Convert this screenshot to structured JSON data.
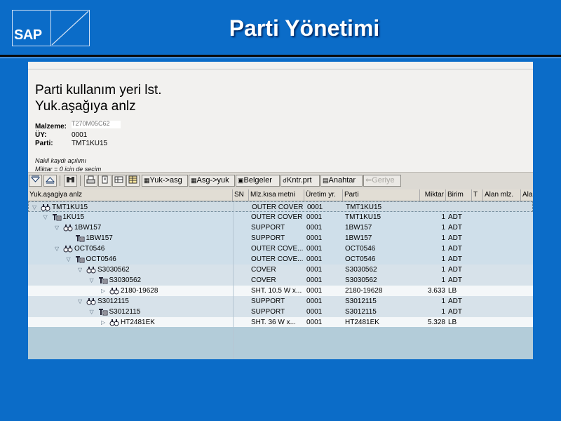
{
  "slide": {
    "title": "Parti Yönetimi",
    "logo_text": "SAP"
  },
  "header": {
    "line1": "Parti kullanım yeri lst.",
    "line2": "Yuk.aşağıya anlz",
    "fields": [
      {
        "label": "Malzeme:",
        "value": "T270M05C62"
      },
      {
        "label": "ÜY:",
        "value": "0001"
      },
      {
        "label": "Parti:",
        "value": "TMT1KU15"
      }
    ],
    "note1": "Nakil kaydı açılımı",
    "note2": "Miktar = 0 için de seçim"
  },
  "toolbar": {
    "buttons": [
      {
        "name": "expand-button",
        "label": ""
      },
      {
        "name": "collapse-button",
        "label": ""
      },
      {
        "name": "find-button",
        "label": ""
      },
      {
        "name": "print-button",
        "label": ""
      },
      {
        "name": "layout-button",
        "label": ""
      },
      {
        "name": "details-button",
        "label": ""
      },
      {
        "name": "export-button",
        "label": ""
      }
    ],
    "yuk_asg": "Yuk->asg",
    "asg_yuk": "Asg->yuk",
    "belgeler": "Belgeler",
    "kntr_prt": "Kntr.prt",
    "anahtar": "Anahtar",
    "geriye": "Geriye"
  },
  "columns": [
    "Yuk.aşagiya anlz",
    "SN",
    "Mlz.kısa metni",
    "Üretim yr.",
    "Parti",
    "Miktar",
    "Birim",
    "T",
    "Alan mlz.",
    "Ala"
  ],
  "rows": [
    {
      "tree": "TMT1KU15",
      "level": 0,
      "toggle": "down",
      "icon": "batch",
      "desc": "OUTER COVER",
      "plant": "0001",
      "batch": "TMT1KU15",
      "qty": "",
      "unit": ""
    },
    {
      "tree": "1KU15",
      "level": 1,
      "toggle": "down",
      "icon": "movement",
      "desc": "OUTER COVER",
      "plant": "0001",
      "batch": "TMT1KU15",
      "qty": "1",
      "unit": "ADT"
    },
    {
      "tree": "1BW157",
      "level": 2,
      "toggle": "down",
      "icon": "batch",
      "desc": "SUPPORT",
      "plant": "0001",
      "batch": "1BW157",
      "qty": "1",
      "unit": "ADT"
    },
    {
      "tree": "1BW157",
      "level": 3,
      "toggle": "",
      "icon": "movement",
      "desc": "SUPPORT",
      "plant": "0001",
      "batch": "1BW157",
      "qty": "1",
      "unit": "ADT"
    },
    {
      "tree": "OCT0546",
      "level": 2,
      "toggle": "down",
      "icon": "batch",
      "desc": "OUTER COVE...",
      "plant": "0001",
      "batch": "OCT0546",
      "qty": "1",
      "unit": "ADT"
    },
    {
      "tree": "OCT0546",
      "level": 3,
      "toggle": "down",
      "icon": "movement",
      "desc": "OUTER COVE...",
      "plant": "0001",
      "batch": "OCT0546",
      "qty": "1",
      "unit": "ADT"
    },
    {
      "tree": "S3030562",
      "level": 4,
      "toggle": "down",
      "icon": "batch",
      "desc": "COVER",
      "plant": "0001",
      "batch": "S3030562",
      "qty": "1",
      "unit": "ADT"
    },
    {
      "tree": "S3030562",
      "level": 5,
      "toggle": "down",
      "icon": "movement",
      "desc": "COVER",
      "plant": "0001",
      "batch": "S3030562",
      "qty": "1",
      "unit": "ADT"
    },
    {
      "tree": "2180-19628",
      "level": 6,
      "toggle": "right",
      "icon": "batch",
      "desc": "SHT.  10.5 W x...",
      "plant": "0001",
      "batch": "2180-19628",
      "qty": "3.633",
      "unit": "LB"
    },
    {
      "tree": "S3012115",
      "level": 4,
      "toggle": "down",
      "icon": "batch",
      "desc": "SUPPORT",
      "plant": "0001",
      "batch": "S3012115",
      "qty": "1",
      "unit": "ADT"
    },
    {
      "tree": "S3012115",
      "level": 5,
      "toggle": "down",
      "icon": "movement",
      "desc": "SUPPORT",
      "plant": "0001",
      "batch": "S3012115",
      "qty": "1",
      "unit": "ADT"
    },
    {
      "tree": "HT2481EK",
      "level": 6,
      "toggle": "right",
      "icon": "batch",
      "desc": "SHT.    36 W x...",
      "plant": "0001",
      "batch": "HT2481EK",
      "qty": "5.328",
      "unit": "LB"
    }
  ],
  "colors": {
    "background": "#0b6cc8",
    "row_blue": "#cfdfea",
    "row_white": "#f4f7f9",
    "header": "#e1ddd4"
  }
}
